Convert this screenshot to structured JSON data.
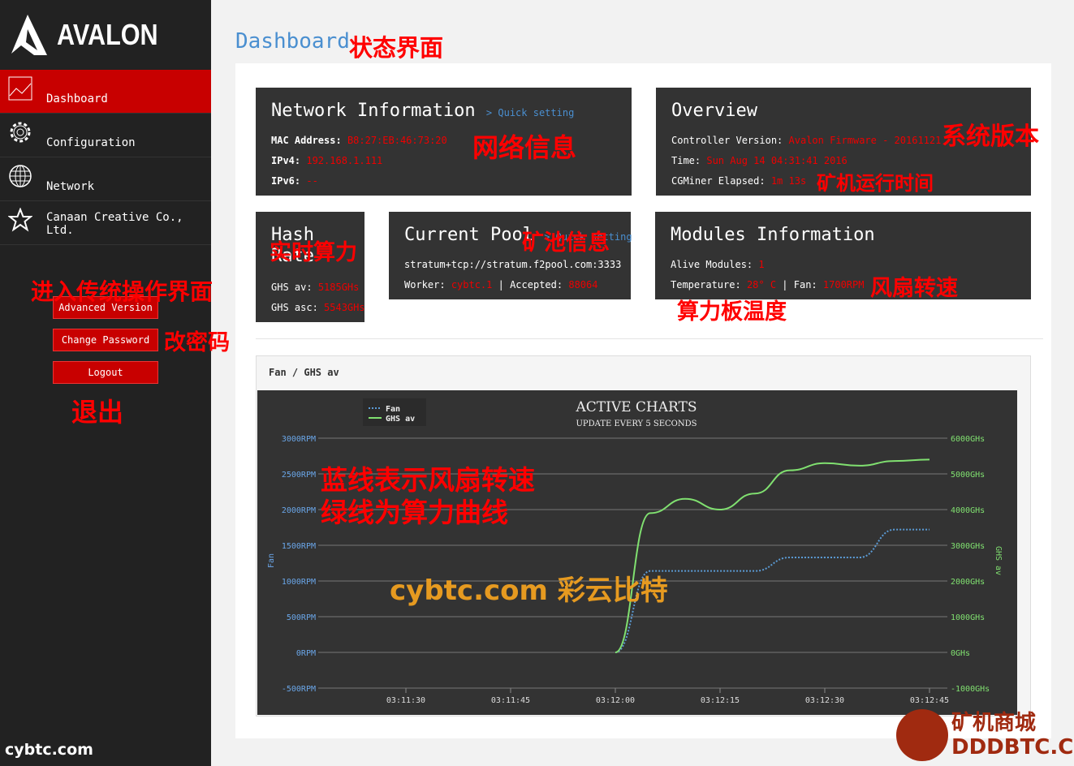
{
  "brand": {
    "name": "AVALON"
  },
  "sidebar": {
    "items": [
      {
        "label": "Dashboard",
        "icon": "chart-icon",
        "active": true
      },
      {
        "label": "Configuration",
        "icon": "gear-icon"
      },
      {
        "label": "Network",
        "icon": "globe-icon"
      },
      {
        "label": "Canaan Creative Co., Ltd.",
        "icon": "star-icon"
      }
    ],
    "buttons": {
      "advanced": "Advanced Version",
      "password": "Change Password",
      "logout": "Logout"
    }
  },
  "page": {
    "title": "Dashboard"
  },
  "network": {
    "title": "Network Information",
    "link": "> Quick setting",
    "mac_label": "MAC Address:",
    "mac": "B8:27:EB:46:73:20",
    "ipv4_label": "IPv4:",
    "ipv4": "192.168.1.111",
    "ipv6_label": "IPv6:",
    "ipv6": "--"
  },
  "overview": {
    "title": "Overview",
    "version_label": "Controller Version:",
    "version": "Avalon Firmware - 20161121",
    "time_label": "Time:",
    "time": "Sun Aug 14 04:31:41 2016",
    "elapsed_label": "CGMiner Elapsed:",
    "elapsed": "1m 13s"
  },
  "hashrate": {
    "title1": "Hash",
    "title2": "Rate",
    "av_label": "GHS av:",
    "av": "5185GHs",
    "asc_label": "GHS asc:",
    "asc": "5543GHs"
  },
  "pool": {
    "title": "Current Pool",
    "link": "> Quick setting",
    "url": "stratum+tcp://stratum.f2pool.com:3333",
    "worker_label": "Worker:",
    "worker": "cybtc.1",
    "accepted_label": "Accepted:",
    "accepted": "88064"
  },
  "modules": {
    "title": "Modules Information",
    "alive_label": "Alive Modules:",
    "alive": "1",
    "temp_label": "Temperature:",
    "temp": "28° C",
    "fan_label": "Fan:",
    "fan": "1700RPM"
  },
  "chart_panel": {
    "heading": "Fan / GHS av"
  },
  "chart_data": {
    "type": "line",
    "title": "ACTIVE CHARTS",
    "subtitle": "UPDATE EVERY 5 SECONDS",
    "x": [
      "03:12:00",
      "03:12:05",
      "03:12:10",
      "03:12:15",
      "03:12:20",
      "03:12:25",
      "03:12:30",
      "03:12:35",
      "03:12:40",
      "03:12:45"
    ],
    "xticks": [
      "03:11:30",
      "03:11:45",
      "03:12:00",
      "03:12:15",
      "03:12:30",
      "03:12:45"
    ],
    "series": [
      {
        "name": "Fan",
        "axis": "left",
        "color": "#5b9bd5",
        "style": "dotted",
        "values": [
          0,
          1140,
          1140,
          1140,
          1140,
          1330,
          1330,
          1330,
          1720,
          1720
        ]
      },
      {
        "name": "GHS av",
        "axis": "right",
        "color": "#80e070",
        "style": "solid",
        "values": [
          0,
          3900,
          4300,
          4000,
          4450,
          5100,
          5300,
          5230,
          5360,
          5400
        ]
      }
    ],
    "ylabel_left": "Fan",
    "ylabel_right": "GHS av",
    "yticks_left": [
      "3000RPM",
      "2500RPM",
      "2000RPM",
      "1500RPM",
      "1000RPM",
      "500RPM",
      "0RPM",
      "-500RPM"
    ],
    "yticks_right": [
      "6000GHs",
      "5000GHs",
      "4000GHs",
      "3000GHs",
      "2000GHs",
      "1000GHs",
      "0GHs",
      "-1000GHs"
    ],
    "ylim_left": [
      -500,
      3000
    ],
    "ylim_right": [
      -1000,
      6000
    ],
    "grid": true,
    "legend": "top-left"
  },
  "annotations": {
    "title": "状态界面",
    "net": "网络信息",
    "ver": "系统版本",
    "elapsed": "矿机运行时间",
    "hash": "实时算力",
    "pool": "矿池信息",
    "fan": "风扇转速",
    "temp": "算力板温度",
    "adv": "进入传统操作界面",
    "pwd": "改密码",
    "logout": "退出",
    "chart1": "蓝线表示风扇转速",
    "chart2": "绿线为算力曲线"
  },
  "watermarks": {
    "left": "cybtc.com",
    "center": "cybtc.com 彩云比特",
    "right": "矿机商城 DDDBTC.COM"
  }
}
